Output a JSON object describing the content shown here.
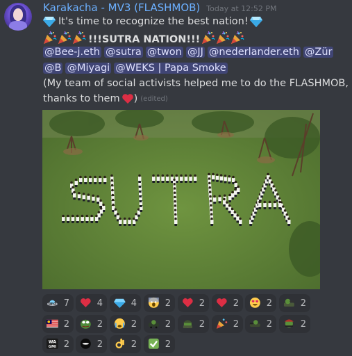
{
  "message": {
    "username": "Karakacha - MV3 (FLASHMOB)",
    "timestamp": "Today at 12:52 PM",
    "line1": "It's time to recognize the best nation!",
    "line2": "!!!SUTRA NATION!!!",
    "mentions_row1": [
      "@Bee-j.eth",
      "@sutra",
      "@twon",
      "@JJ",
      "@nederlander.eth",
      "@Zür"
    ],
    "mentions_row2": [
      "@B",
      "@Miyagi",
      "@WEKS | Papa Smoke"
    ],
    "body_line1": "(My team of social activists helped me to do the FLASHMOB,",
    "body_line2": "thanks to them",
    "body_line2_end": ")",
    "edited": "(edited)"
  },
  "photo": {
    "alt_text": "SUTRA"
  },
  "reactions": [
    {
      "icon": "ufo-emoji-icon",
      "count": "7"
    },
    {
      "icon": "red-heart-icon",
      "count": "4"
    },
    {
      "icon": "gem-icon",
      "count": "4"
    },
    {
      "icon": "screaming-face-icon",
      "count": "2"
    },
    {
      "icon": "heart-exclamation-icon",
      "count": "2"
    },
    {
      "icon": "red-heart-icon",
      "count": "2"
    },
    {
      "icon": "heart-eyes-icon",
      "count": "2"
    },
    {
      "icon": "frog-tank-icon",
      "count": "2"
    },
    {
      "icon": "malaysia-flag-icon",
      "count": "2"
    },
    {
      "icon": "pepe-icon",
      "count": "2"
    },
    {
      "icon": "crying-face-icon",
      "count": "2"
    },
    {
      "icon": "frog-car-icon",
      "count": "2"
    },
    {
      "icon": "frog-army-icon",
      "count": "2"
    },
    {
      "icon": "party-popper-icon",
      "count": "2"
    },
    {
      "icon": "frog-dog-icon",
      "count": "2"
    },
    {
      "icon": "frog-ak-icon",
      "count": "2"
    },
    {
      "icon": "wagmi-icon",
      "count": "2"
    },
    {
      "icon": "black-orb-icon",
      "count": "2"
    },
    {
      "icon": "ok-hand-icon",
      "count": "2"
    },
    {
      "icon": "check-mark-icon",
      "count": "2"
    }
  ],
  "reaction_badge_text": {
    "ufo": "UFO",
    "wagmi_top": "WA",
    "wagmi_bottom": "GMI"
  },
  "colors": {
    "background": "#36393f",
    "username": "#6cb0ff",
    "mention_bg": "rgba(88,101,242,0.3)",
    "reaction_bg": "#2f3136"
  }
}
